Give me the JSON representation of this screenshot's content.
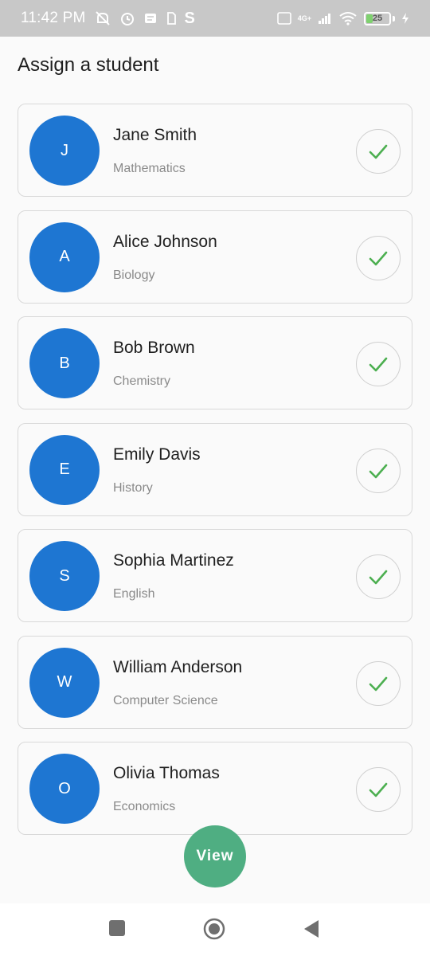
{
  "status_bar": {
    "time": "11:42 PM",
    "carrier_badge": "S",
    "network_label": "4G+",
    "battery_level": "25",
    "battery_fraction": 0.25
  },
  "page": {
    "title": "Assign a student"
  },
  "students": [
    {
      "initial": "J",
      "name": "Jane Smith",
      "subject": "Mathematics"
    },
    {
      "initial": "A",
      "name": "Alice Johnson",
      "subject": "Biology"
    },
    {
      "initial": "B",
      "name": "Bob Brown",
      "subject": "Chemistry"
    },
    {
      "initial": "E",
      "name": "Emily Davis",
      "subject": "History"
    },
    {
      "initial": "S",
      "name": "Sophia Martinez",
      "subject": "English"
    },
    {
      "initial": "W",
      "name": "William Anderson",
      "subject": "Computer Science"
    },
    {
      "initial": "O",
      "name": "Olivia Thomas",
      "subject": "Economics"
    }
  ],
  "fab": {
    "label": "View"
  },
  "colors": {
    "avatar": "#1e76d2",
    "check": "#4caf50",
    "fab": "#4fae82"
  },
  "icons": {
    "check": "check-icon",
    "nav_recents": "square-icon",
    "nav_home": "circle-icon",
    "nav_back": "back-triangle-icon"
  }
}
